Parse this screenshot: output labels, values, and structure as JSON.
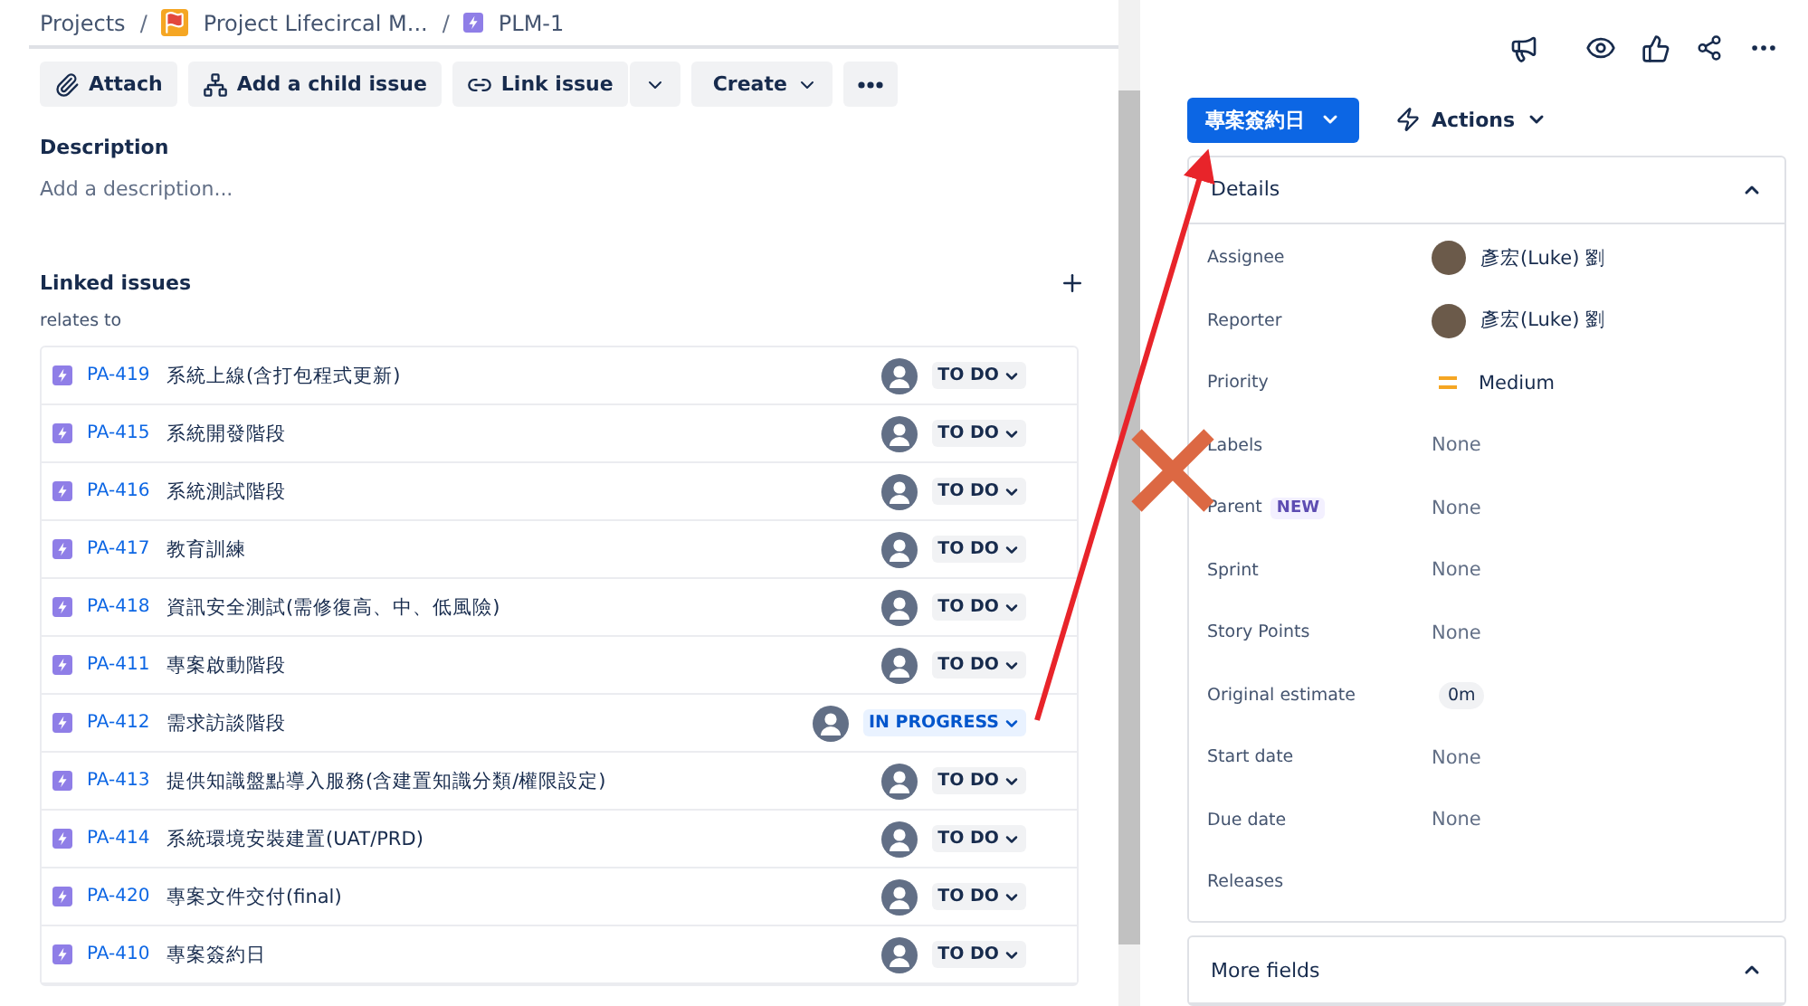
{
  "breadcrumbs": [
    {
      "label": "Projects",
      "kind": "text"
    },
    {
      "separator": "/",
      "label": "Project Lifecircal M...",
      "kind": "project"
    },
    {
      "separator": "/",
      "label": "PLM-1",
      "kind": "issue"
    }
  ],
  "toolbar": {
    "attach": "Attach",
    "add_child": "Add a child issue",
    "link_issue": "Link issue",
    "create": "Create"
  },
  "description": {
    "title": "Description",
    "placeholder": "Add a description..."
  },
  "linked_issues": {
    "title": "Linked issues",
    "relation": "relates to",
    "rows": [
      {
        "key": "PA-419",
        "summary": "系統上線(含打包程式更新)",
        "status": "TO DO",
        "kind": "todo"
      },
      {
        "key": "PA-415",
        "summary": "系統開發階段",
        "status": "TO DO",
        "kind": "todo"
      },
      {
        "key": "PA-416",
        "summary": "系統測試階段",
        "status": "TO DO",
        "kind": "todo"
      },
      {
        "key": "PA-417",
        "summary": "教育訓練",
        "status": "TO DO",
        "kind": "todo"
      },
      {
        "key": "PA-418",
        "summary": "資訊安全測試(需修復高、中、低風險)",
        "status": "TO DO",
        "kind": "todo"
      },
      {
        "key": "PA-411",
        "summary": "專案啟動階段",
        "status": "TO DO",
        "kind": "todo"
      },
      {
        "key": "PA-412",
        "summary": "需求訪談階段",
        "status": "IN PROGRESS",
        "kind": "progress"
      },
      {
        "key": "PA-413",
        "summary": "提供知識盤點導入服務(含建置知識分類/權限設定)",
        "status": "TO DO",
        "kind": "todo"
      },
      {
        "key": "PA-414",
        "summary": "系統環境安裝建置(UAT/PRD)",
        "status": "TO DO",
        "kind": "todo"
      },
      {
        "key": "PA-420",
        "summary": "專案文件交付(final)",
        "status": "TO DO",
        "kind": "todo"
      },
      {
        "key": "PA-410",
        "summary": "專案簽約日",
        "status": "TO DO",
        "kind": "todo"
      }
    ]
  },
  "status_button": "專案簽約日",
  "actions": "Actions",
  "details": {
    "title": "Details",
    "expanded": true,
    "fields": [
      {
        "label": "Assignee",
        "value": "彥宏(Luke) 劉",
        "kind": "user"
      },
      {
        "label": "Reporter",
        "value": "彥宏(Luke) 劉",
        "kind": "user"
      },
      {
        "label": "Priority",
        "value": "Medium",
        "kind": "priority"
      },
      {
        "label": "Labels",
        "value": "None",
        "kind": "text"
      },
      {
        "label": "Parent",
        "badge": "NEW",
        "value": "None",
        "kind": "text"
      },
      {
        "label": "Sprint",
        "value": "None",
        "kind": "text"
      },
      {
        "label": "Story Points",
        "value": "None",
        "kind": "text"
      },
      {
        "label": "Original estimate",
        "value": "0m",
        "kind": "estimate"
      },
      {
        "label": "Start date",
        "value": "None",
        "kind": "text"
      },
      {
        "label": "Due date",
        "value": "None",
        "kind": "text"
      },
      {
        "label": "Releases",
        "kind": "empty"
      }
    ]
  },
  "more_fields": {
    "title": "More fields",
    "expanded": true
  }
}
